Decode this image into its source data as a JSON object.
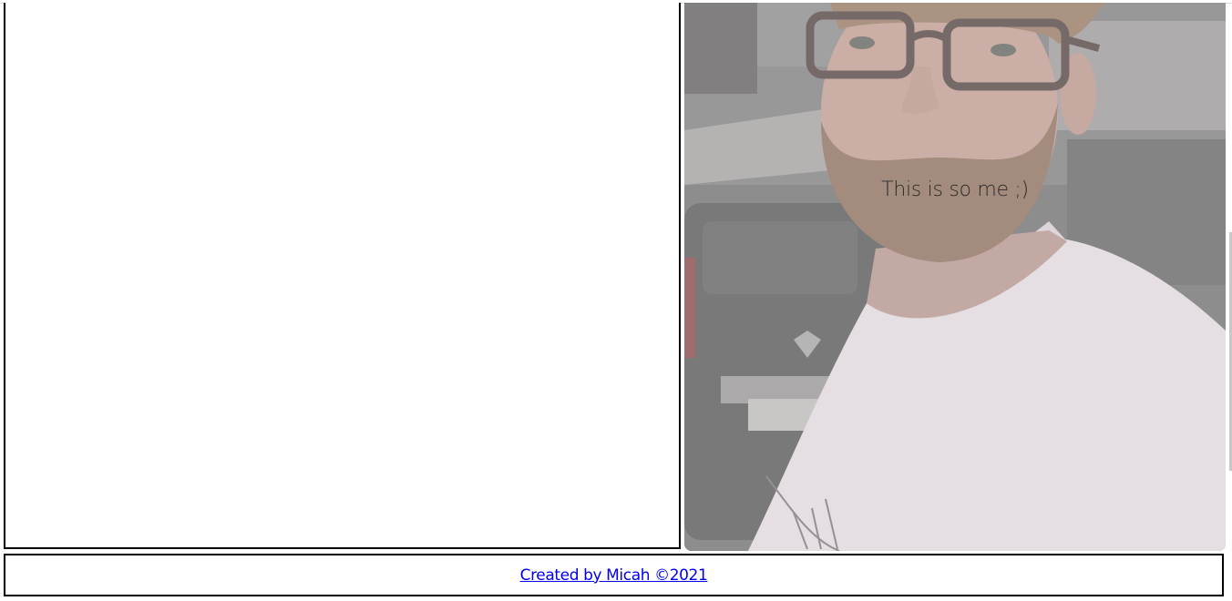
{
  "photo": {
    "caption": "This is so me ;)",
    "description_icon": "portrait-photo"
  },
  "footer": {
    "credit_link": "Created by Micah ©2021"
  },
  "colors": {
    "border": "#000000",
    "link": "#0000ee",
    "overlay": "#e9dfe6"
  }
}
